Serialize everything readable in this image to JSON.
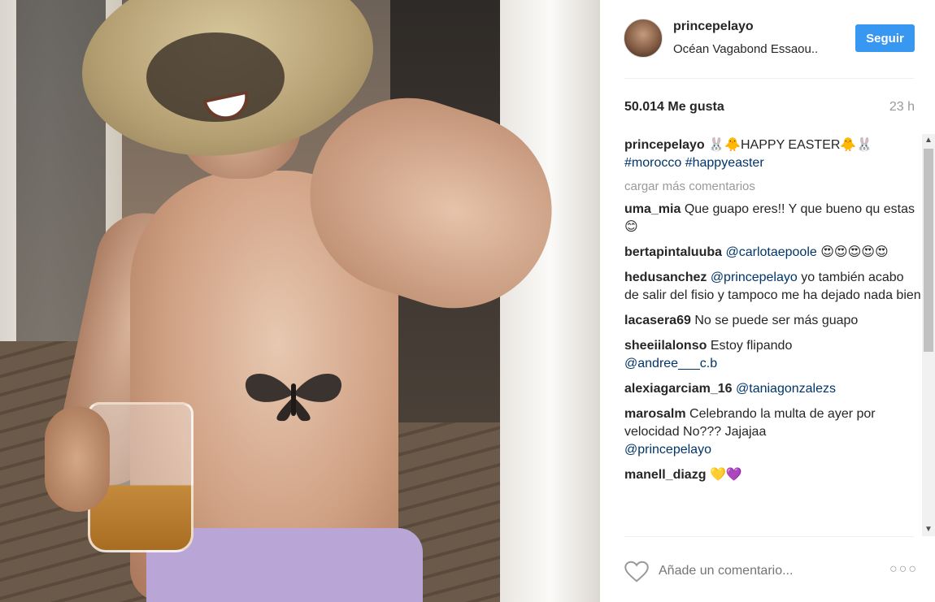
{
  "post": {
    "username": "princepelayo",
    "location": "Océan Vagabond Essaou..",
    "follow_label": "Seguir",
    "likes": "50.014 Me gusta",
    "time": "23 h"
  },
  "caption": {
    "user": "princepelayo",
    "text": "🐰🐥HAPPY EASTER🐥🐰",
    "tags": "#morocco #happyeaster"
  },
  "load_more": "cargar más comentarios",
  "comments": [
    {
      "user": "uma_mia",
      "mention": "",
      "text": "Que guapo eres!! Y que bueno qu estas 😊"
    },
    {
      "user": "bertapintaluuba",
      "mention": "@carlotaepoole",
      "text": "😍😍😍😍😍"
    },
    {
      "user": "hedusanchez",
      "mention": "@princepelayo",
      "text": "yo también acabo de salir del fisio y tampoco me ha dejado nada bien"
    },
    {
      "user": "lacasera69",
      "mention": "",
      "text": "No se puede ser más guapo"
    },
    {
      "user": "sheeiilalonso",
      "mention": "",
      "text": "Estoy flipando",
      "trailing_mention": "@andree___c.b"
    },
    {
      "user": "alexiagarciam_16",
      "mention": "@taniagonzalezs",
      "text": ""
    },
    {
      "user": "marosalm",
      "mention": "",
      "text": "Celebrando la multa de ayer por velocidad No??? Jajajaa",
      "trailing_mention": "@princepelayo"
    },
    {
      "user": "manell_diazg",
      "mention": "",
      "text": "💛💜"
    }
  ],
  "add_comment_placeholder": "Añade un comentario...",
  "more_label": "○○○",
  "icons": {
    "heart": "heart-outline-icon",
    "more": "more-options-icon",
    "scroll_up": "scroll-up-arrow-icon",
    "scroll_down": "scroll-down-arrow-icon"
  },
  "colors": {
    "follow_button": "#3897f0",
    "mention": "#003569",
    "muted": "#999999"
  }
}
